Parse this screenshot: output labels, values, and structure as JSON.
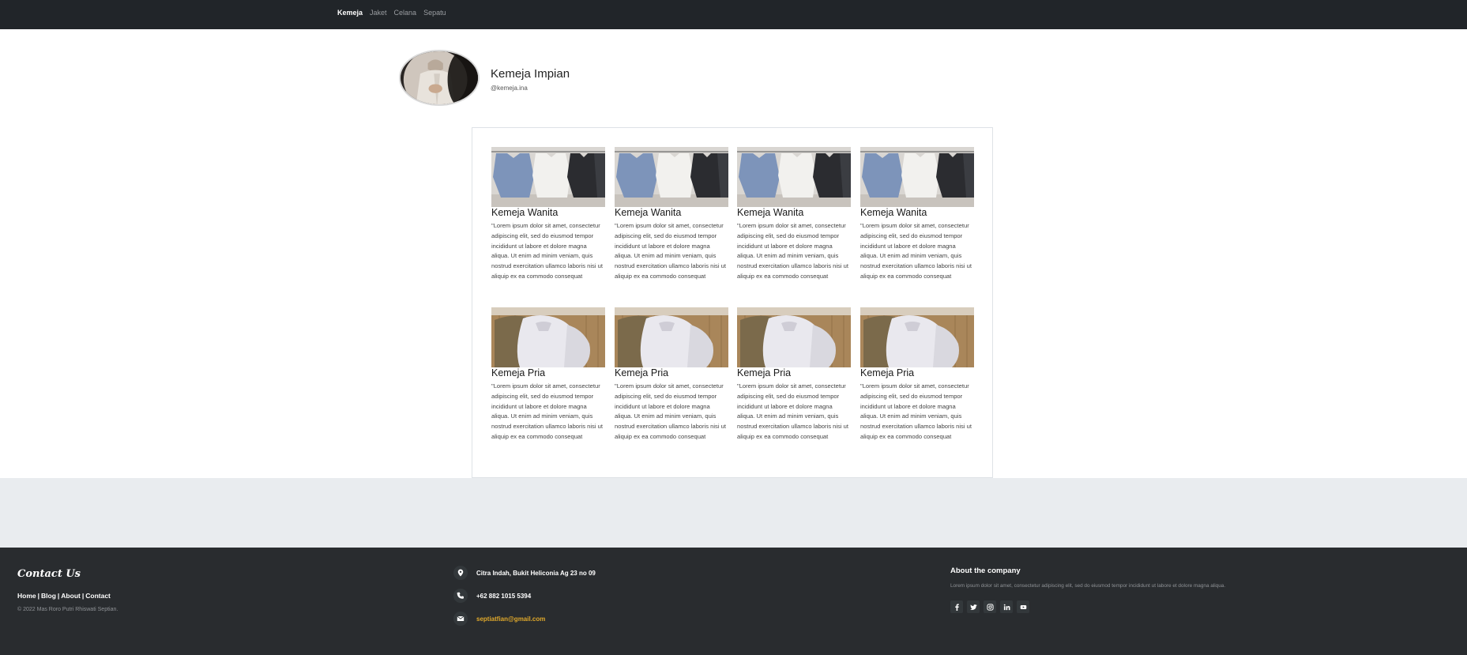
{
  "nav": {
    "items": [
      {
        "label": "Kemeja",
        "active": true
      },
      {
        "label": "Jaket",
        "active": false
      },
      {
        "label": "Celana",
        "active": false
      },
      {
        "label": "Sepatu",
        "active": false
      }
    ]
  },
  "profile": {
    "name": "Kemeja Impian",
    "handle": "@kemeja.ina"
  },
  "products": {
    "row1": [
      {
        "title": "Kemeja Wanita",
        "description": "\"Lorem ipsum dolor sit amet, consectetur adipiscing elit, sed do eiusmod tempor incididunt ut labore et dolore magna aliqua. Ut enim ad minim veniam, quis nostrud exercitation ullamco laboris nisi ut aliquip ex ea commodo consequat"
      },
      {
        "title": "Kemeja Wanita",
        "description": "\"Lorem ipsum dolor sit amet, consectetur adipiscing elit, sed do eiusmod tempor incididunt ut labore et dolore magna aliqua. Ut enim ad minim veniam, quis nostrud exercitation ullamco laboris nisi ut aliquip ex ea commodo consequat"
      },
      {
        "title": "Kemeja Wanita",
        "description": "\"Lorem ipsum dolor sit amet, consectetur adipiscing elit, sed do eiusmod tempor incididunt ut labore et dolore magna aliqua. Ut enim ad minim veniam, quis nostrud exercitation ullamco laboris nisi ut aliquip ex ea commodo consequat"
      },
      {
        "title": "Kemeja Wanita",
        "description": "\"Lorem ipsum dolor sit amet, consectetur adipiscing elit, sed do eiusmod tempor incididunt ut labore et dolore magna aliqua. Ut enim ad minim veniam, quis nostrud exercitation ullamco laboris nisi ut aliquip ex ea commodo consequat"
      }
    ],
    "row2": [
      {
        "title": "Kemeja Pria",
        "description": "\"Lorem ipsum dolor sit amet, consectetur adipiscing elit, sed do eiusmod tempor incididunt ut labore et dolore magna aliqua. Ut enim ad minim veniam, quis nostrud exercitation ullamco laboris nisi ut aliquip ex ea commodo consequat"
      },
      {
        "title": "Kemeja Pria",
        "description": "\"Lorem ipsum dolor sit amet, consectetur adipiscing elit, sed do eiusmod tempor incididunt ut labore et dolore magna aliqua. Ut enim ad minim veniam, quis nostrud exercitation ullamco laboris nisi ut aliquip ex ea commodo consequat"
      },
      {
        "title": "Kemeja Pria",
        "description": "\"Lorem ipsum dolor sit amet, consectetur adipiscing elit, sed do eiusmod tempor incididunt ut labore et dolore magna aliqua. Ut enim ad minim veniam, quis nostrud exercitation ullamco laboris nisi ut aliquip ex ea commodo consequat"
      },
      {
        "title": "Kemeja Pria",
        "description": "\"Lorem ipsum dolor sit amet, consectetur adipiscing elit, sed do eiusmod tempor incididunt ut labore et dolore magna aliqua. Ut enim ad minim veniam, quis nostrud exercitation ullamco laboris nisi ut aliquip ex ea commodo consequat"
      }
    ]
  },
  "footer": {
    "brand": "Contact Us",
    "links": [
      "Home",
      "Blog",
      "About",
      "Contact"
    ],
    "link_separator": "|",
    "copyright": "© 2022 Mas Roro Putri Rhiswati Septian.",
    "contact": {
      "address": "Citra Indah, Bukit Heliconia Ag 23 no 09",
      "phone": "+62 882 1015 5394",
      "email": "septiatfian@gmail.com"
    },
    "about": {
      "title": "About the company",
      "text": "Lorem ipsum dolor sit amet, consectetur adipiscing elit, sed do eiusmod tempor incididunt ut labore et dolore magna aliqua."
    },
    "social": [
      "facebook-icon",
      "twitter-icon",
      "instagram-icon",
      "linkedin-icon",
      "youtube-icon"
    ]
  },
  "colors": {
    "navbar_bg": "#212529",
    "footer_bg": "#292c2f",
    "band_bg": "#e9ecef",
    "email_accent": "#e0a92b"
  }
}
